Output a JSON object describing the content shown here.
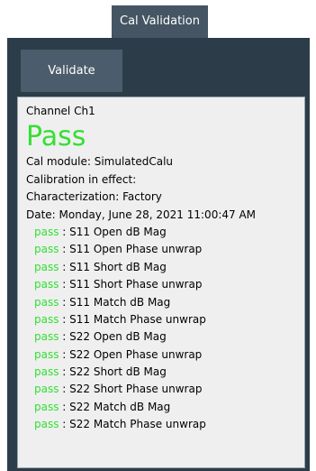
{
  "tab": {
    "label": "Cal Validation"
  },
  "toolbar": {
    "validate_label": "Validate"
  },
  "results": {
    "channel": "Channel Ch1",
    "overall": "Pass",
    "cal_module": "Cal module: SimulatedCalu",
    "calibration": "Calibration in effect:",
    "characterization": "Characterization: Factory",
    "date": "Date: Monday, June 28, 2021 11:00:47 AM",
    "separator": " : ",
    "checks": [
      {
        "status": "pass",
        "name": "S11 Open dB Mag"
      },
      {
        "status": "pass",
        "name": "S11 Open Phase unwrap"
      },
      {
        "status": "pass",
        "name": "S11 Short dB Mag"
      },
      {
        "status": "pass",
        "name": "S11 Short Phase unwrap"
      },
      {
        "status": "pass",
        "name": "S11 Match dB Mag"
      },
      {
        "status": "pass",
        "name": "S11 Match Phase unwrap"
      },
      {
        "status": "pass",
        "name": "S22 Open dB Mag"
      },
      {
        "status": "pass",
        "name": "S22 Open Phase unwrap"
      },
      {
        "status": "pass",
        "name": "S22 Short dB Mag"
      },
      {
        "status": "pass",
        "name": "S22 Short Phase unwrap"
      },
      {
        "status": "pass",
        "name": "S22 Match dB Mag"
      },
      {
        "status": "pass",
        "name": "S22 Match Phase unwrap"
      }
    ]
  },
  "colors": {
    "tab_bg": "#455563",
    "panel_bg": "#2c3d49",
    "button_bg": "#4b5d6c",
    "results_bg": "#efefef",
    "pass_green": "#33e033"
  }
}
